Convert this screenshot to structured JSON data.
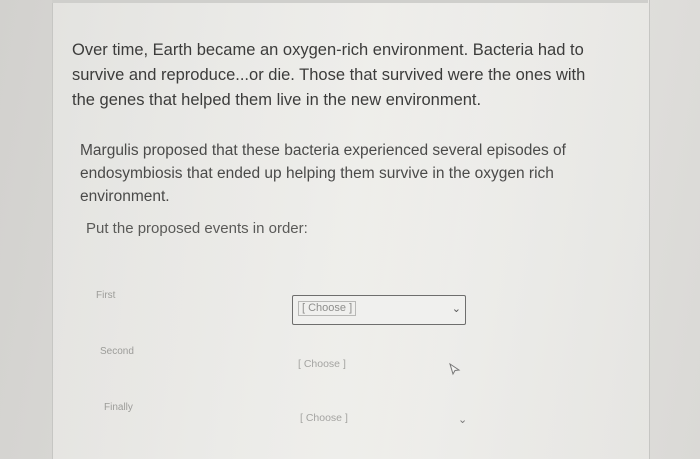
{
  "question": {
    "paragraph1": "Over time, Earth became an oxygen-rich environment. Bacteria had to survive and reproduce...or die. Those that survived were the ones with the genes that helped them live in the new environment.",
    "paragraph2": "Margulis proposed that these bacteria experienced several episodes of endosymbiosis that ended up helping them survive in the oxygen rich environment.",
    "prompt": "Put the proposed events in order:"
  },
  "matching": {
    "rows": [
      {
        "label": "First",
        "selected": "[ Choose ]"
      },
      {
        "label": "Second",
        "selected": "[ Choose ]"
      },
      {
        "label": "Finally",
        "selected": "[ Choose ]"
      }
    ]
  }
}
